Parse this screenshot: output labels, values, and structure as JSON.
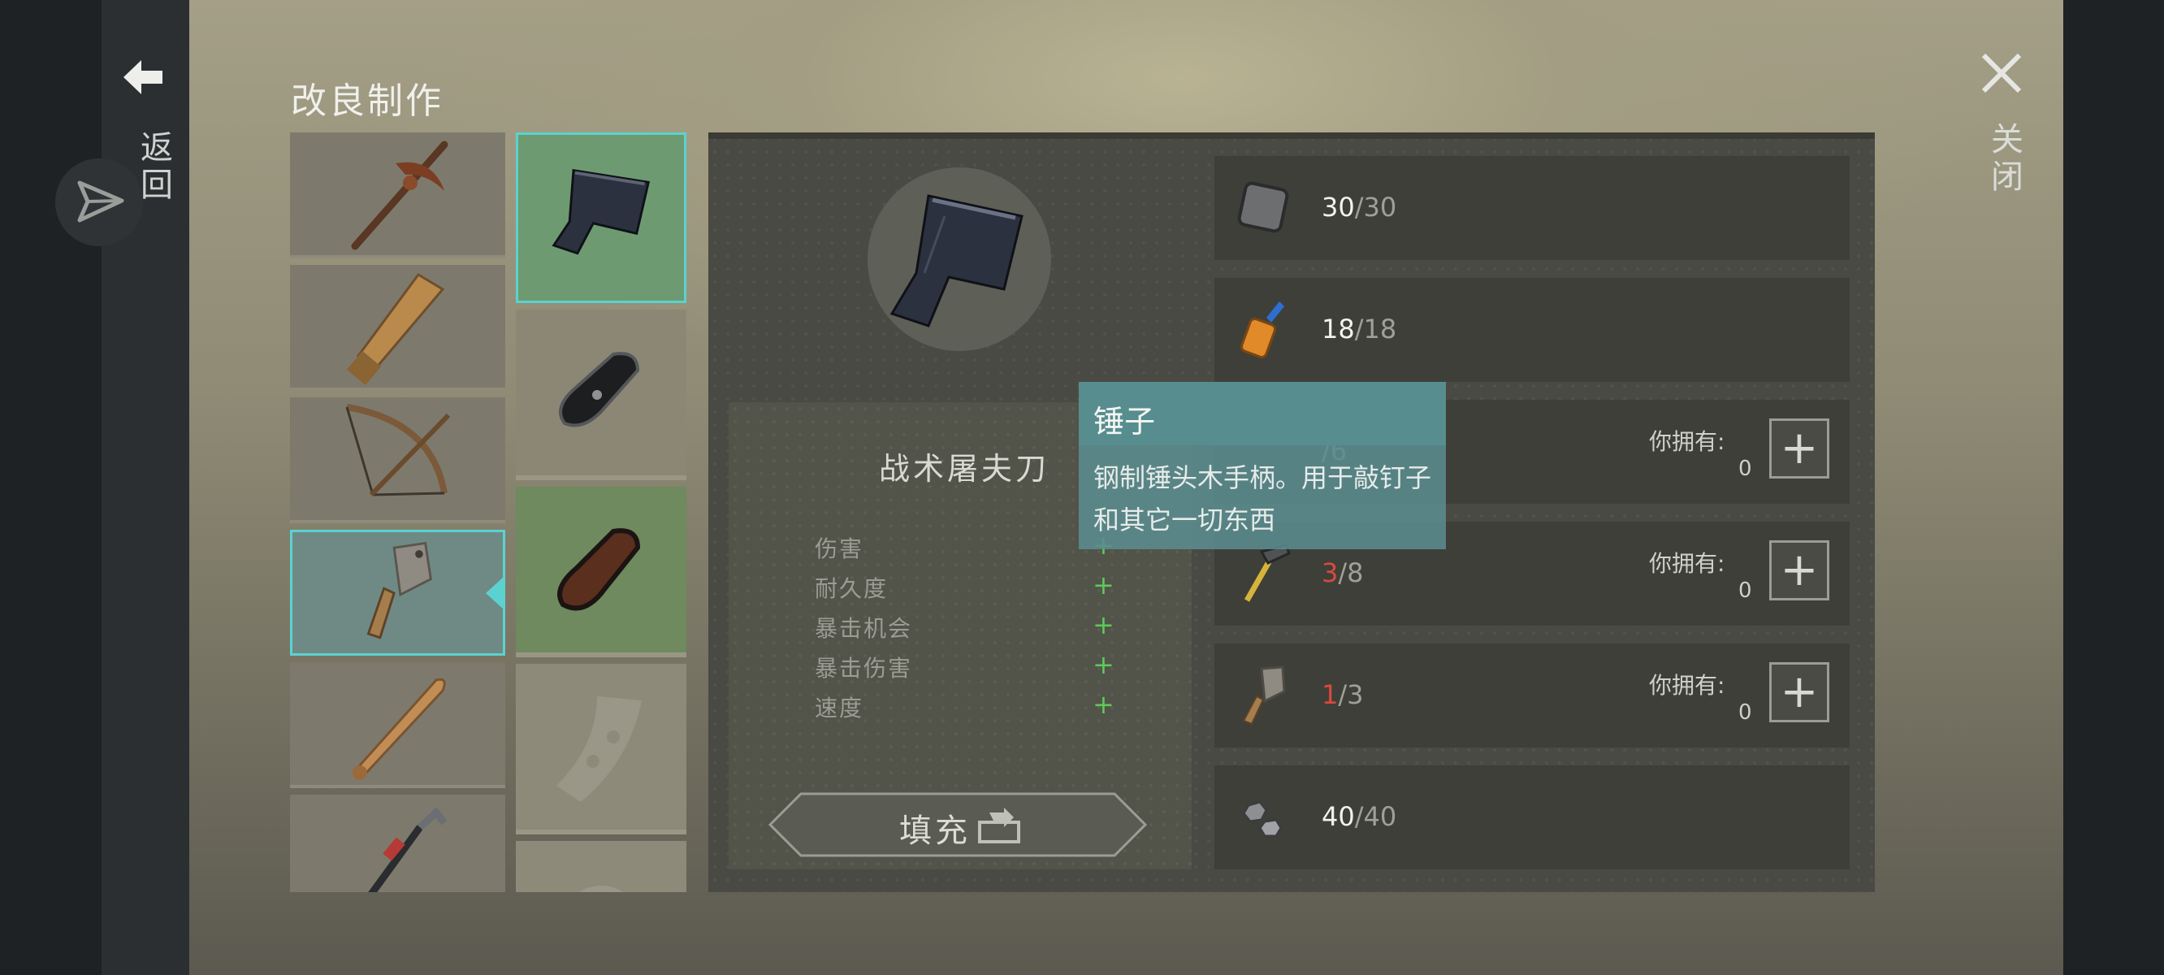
{
  "header": {
    "title": "改良制作",
    "back_label": "返回",
    "close_label": "关闭"
  },
  "weapons": [
    {
      "icon": "pickaxe-icon"
    },
    {
      "icon": "wooden-plank-icon"
    },
    {
      "icon": "crossbow-icon"
    },
    {
      "icon": "cleaver-icon",
      "selected": true
    },
    {
      "icon": "baseball-bat-icon"
    },
    {
      "icon": "crowbar-icon"
    }
  ],
  "upgrades": [
    {
      "icon": "tactical-cleaver-icon",
      "selected": true
    },
    {
      "icon": "black-grip-icon"
    },
    {
      "icon": "wooden-grip-icon"
    },
    {
      "icon": "blade-part-icon"
    },
    {
      "icon": "round-part-icon"
    }
  ],
  "item": {
    "name": "战术屠夫刀",
    "stats": [
      {
        "label": "伤害",
        "value": "+"
      },
      {
        "label": "耐久度",
        "value": "+"
      },
      {
        "label": "暴击机会",
        "value": "+"
      },
      {
        "label": "暴击伤害",
        "value": "+"
      },
      {
        "label": "速度",
        "value": "+"
      }
    ],
    "fill_button": "填充"
  },
  "materials": [
    {
      "icon": "metal-plate-icon",
      "have": "30",
      "sep": "/",
      "need": "30",
      "short": false
    },
    {
      "icon": "glue-icon",
      "have": "18",
      "sep": "/",
      "need": "18",
      "short": false
    },
    {
      "icon": "blade-material-icon",
      "have": "",
      "sep": "",
      "need": "/6",
      "short": false,
      "owned_label": "你拥有:",
      "owned": "0"
    },
    {
      "icon": "hammer-icon",
      "have": "3",
      "sep": "/",
      "need": "8",
      "short": true,
      "owned_label": "你拥有:",
      "owned": "0"
    },
    {
      "icon": "cleaver-icon",
      "have": "1",
      "sep": "/",
      "need": "3",
      "short": true,
      "owned_label": "你拥有:",
      "owned": "0"
    },
    {
      "icon": "nuts-bolts-icon",
      "have": "40",
      "sep": "/",
      "need": "40",
      "short": false
    }
  ],
  "tooltip": {
    "title": "锤子",
    "description": "钢制锤头木手柄。用于敲钉子和其它一切东西"
  },
  "colors": {
    "accent": "#5bd2d0",
    "plus": "#5ec85b",
    "short": "#d94a3e"
  }
}
